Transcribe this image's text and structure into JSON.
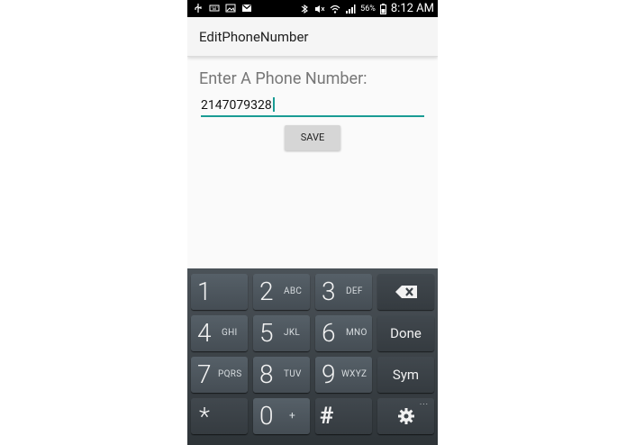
{
  "status_bar": {
    "left_icons": [
      "usb-icon",
      "keyboard-icon",
      "image-icon",
      "gmail-icon"
    ],
    "right_icons": [
      "bluetooth-icon",
      "mute-icon",
      "wifi-icon",
      "signal-icon",
      "battery-icon"
    ],
    "battery_percent": "56%",
    "time": "8:12 AM"
  },
  "app_bar": {
    "title": "EditPhoneNumber"
  },
  "main": {
    "prompt": "Enter A Phone Number:",
    "phone_value": "2147079328",
    "save_label": "SAVE"
  },
  "keyboard": {
    "keys": [
      {
        "main": "1",
        "sub": ""
      },
      {
        "main": "2",
        "sub": "ABC"
      },
      {
        "main": "3",
        "sub": "DEF"
      },
      {
        "main": "4",
        "sub": "GHI"
      },
      {
        "main": "5",
        "sub": "JKL"
      },
      {
        "main": "6",
        "sub": "MNO"
      },
      {
        "main": "7",
        "sub": "PQRS"
      },
      {
        "main": "8",
        "sub": "TUV"
      },
      {
        "main": "9",
        "sub": "WXYZ"
      },
      {
        "main": "*",
        "sub": ""
      },
      {
        "main": "0",
        "sub": "+"
      },
      {
        "main": "#",
        "sub": ""
      }
    ],
    "done_label": "Done",
    "sym_label": "Sym",
    "more_dots": "..."
  }
}
